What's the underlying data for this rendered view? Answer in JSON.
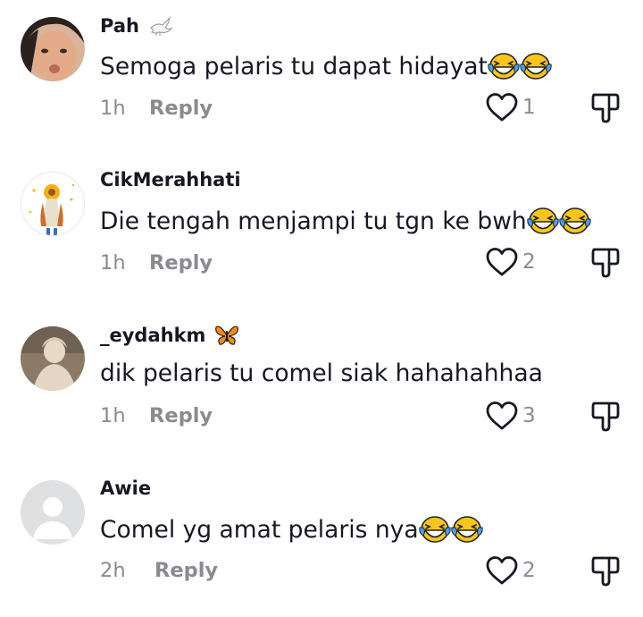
{
  "comments": [
    {
      "username": "Pah",
      "badge": "dove-icon",
      "text": "Semoga pelaris tu dapat hidayat",
      "emoji_count": 2,
      "time": "1h",
      "reply_label": "Reply",
      "likes": "1"
    },
    {
      "username": "CikMerahhati",
      "badge": "",
      "text": "Die tengah menjampi tu tgn ke bwh",
      "emoji_count": 2,
      "time": "1h",
      "reply_label": "Reply",
      "likes": "2"
    },
    {
      "username": "_eydahkm",
      "badge": "butterfly-icon",
      "text": "dik pelaris tu comel siak hahahahhaa",
      "emoji_count": 0,
      "time": "1h",
      "reply_label": "Reply",
      "likes": "3"
    },
    {
      "username": "Awie",
      "badge": "",
      "text": "Comel yg amat pelaris nya",
      "emoji_count": 2,
      "time": "2h",
      "reply_label": "Reply",
      "likes": "2"
    }
  ],
  "colors": {
    "text": "#161823",
    "muted": "#8a8b91",
    "emoji_face": "#f7c51d",
    "tears": "#4d9ef0"
  }
}
